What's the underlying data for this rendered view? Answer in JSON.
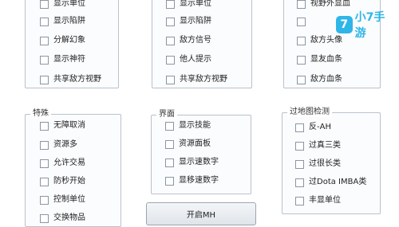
{
  "panels": {
    "top_left": {
      "title": "",
      "items": [
        "显示单位",
        "显示陷阱",
        "分解幻象",
        "显示神符",
        "共享敌方视野"
      ]
    },
    "top_middle": {
      "title": "",
      "items": [
        "显示单位",
        "显示陷阱",
        "敌方信号",
        "他人提示",
        "共享敌方视野"
      ]
    },
    "top_right": {
      "title": "",
      "items": [
        "视野外显血",
        "",
        "敌方头像",
        "显友血条",
        "敌方血条"
      ]
    },
    "special": {
      "title": "特殊",
      "items": [
        "无障取消",
        "资源多",
        "允许交易",
        "防秒开始",
        "控制单位",
        "交换物品"
      ]
    },
    "interface": {
      "title": "界面",
      "items": [
        "显示技能",
        "资源面板",
        "显示速数字",
        "显移速数字"
      ]
    },
    "map_detect": {
      "title": "过地图检测",
      "items": [
        "反-AH",
        "过真三类",
        "过很长类",
        "过Dota IMBA类",
        "丰显单位"
      ]
    }
  },
  "button": {
    "label": "开启MH"
  },
  "watermark": {
    "icon": "7",
    "text": "小7手游"
  }
}
